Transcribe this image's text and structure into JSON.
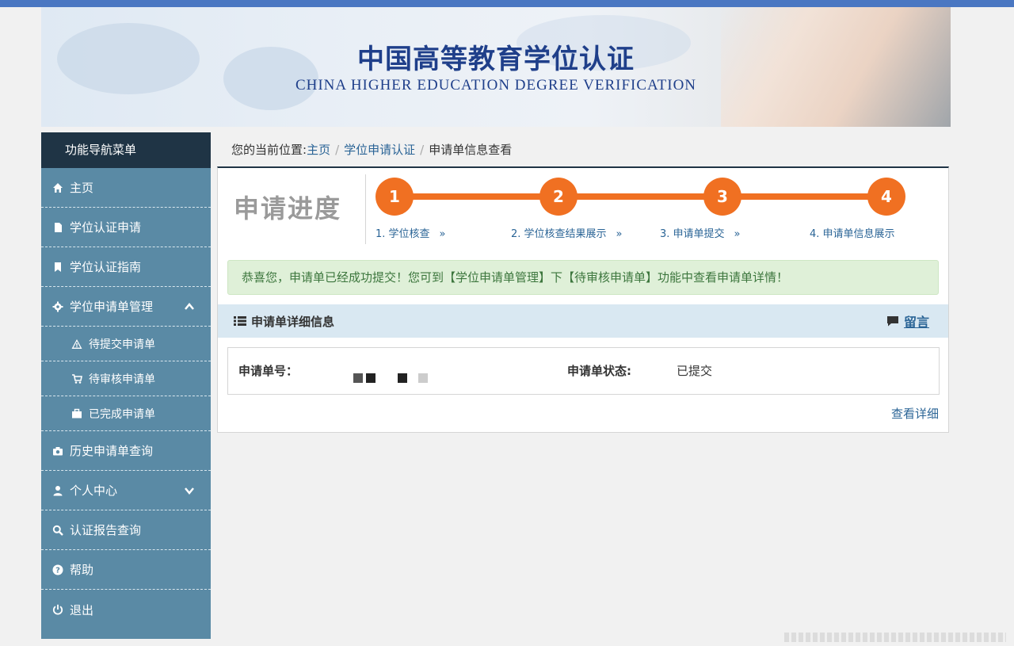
{
  "header": {
    "title": "中国高等教育学位认证",
    "subtitle": "CHINA HIGHER EDUCATION DEGREE VERIFICATION"
  },
  "sidebar": {
    "heading": "功能导航菜单",
    "items": [
      {
        "label": "主页",
        "icon": "home-icon"
      },
      {
        "label": "学位认证申请",
        "icon": "file-icon"
      },
      {
        "label": "学位认证指南",
        "icon": "bookmark-icon"
      },
      {
        "label": "学位申请单管理",
        "icon": "gear-icon",
        "expanded": true
      },
      {
        "label": "待提交申请单",
        "icon": "warning-icon",
        "sub": true
      },
      {
        "label": "待审核申请单",
        "icon": "cart-icon",
        "sub": true
      },
      {
        "label": "已完成申请单",
        "icon": "briefcase-icon",
        "sub": true
      },
      {
        "label": "历史申请单查询",
        "icon": "camera-icon"
      },
      {
        "label": "个人中心",
        "icon": "user-icon",
        "expanded": false
      },
      {
        "label": "认证报告查询",
        "icon": "search-icon"
      },
      {
        "label": "帮助",
        "icon": "question-icon"
      },
      {
        "label": "退出",
        "icon": "power-icon"
      }
    ]
  },
  "breadcrumb": {
    "prefix": "您的当前位置:",
    "items": [
      "主页",
      "学位申请认证",
      "申请单信息查看"
    ]
  },
  "progress": {
    "title": "申请进度",
    "steps": [
      {
        "number": "1",
        "label": "1. 学位核查",
        "arrow": "»"
      },
      {
        "number": "2",
        "label": "2. 学位核查结果展示",
        "arrow": "»"
      },
      {
        "number": "3",
        "label": "3. 申请单提交",
        "arrow": "»"
      },
      {
        "number": "4",
        "label": "4. 申请单信息展示",
        "arrow": ""
      }
    ],
    "current_step": 4,
    "color": "#f07022"
  },
  "alert": {
    "text": "恭喜您，申请单已经成功提交！您可到【学位申请单管理】下【待审核申请单】功能中查看申请单详情！"
  },
  "details": {
    "heading": "申请单详细信息",
    "message_link": "留言",
    "order_number_label": "申请单号：",
    "status_label": "申请单状态:",
    "status_value": "已提交",
    "view_details": "查看详细"
  },
  "colors": {
    "sidebar_bg": "#5a8aa5",
    "sidebar_head": "#1f3445",
    "link": "#2a6496",
    "alert_bg": "#dff0d8"
  }
}
